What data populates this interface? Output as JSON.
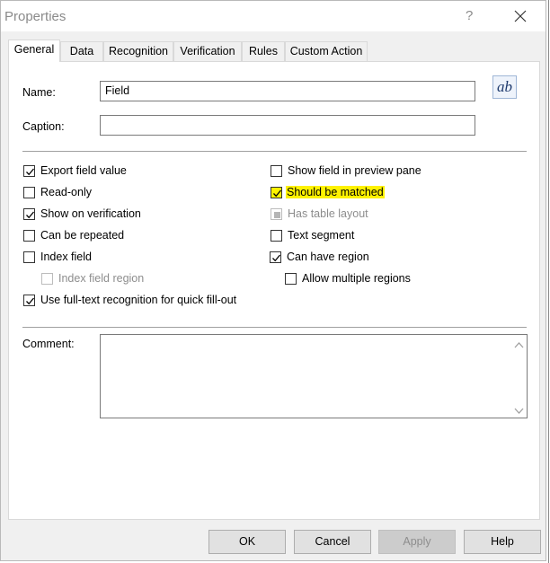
{
  "window": {
    "title": "Properties",
    "help_glyph": "?"
  },
  "tabs": [
    {
      "label": "General",
      "active": true
    },
    {
      "label": "Data"
    },
    {
      "label": "Recognition"
    },
    {
      "label": "Verification"
    },
    {
      "label": "Rules"
    },
    {
      "label": "Custom Action"
    }
  ],
  "general": {
    "name_label": "Name:",
    "name_value": "Field",
    "caption_label": "Caption:",
    "caption_value": "",
    "ab_button": "ab",
    "checkboxes_left": [
      {
        "label": "Export field value",
        "checked": true
      },
      {
        "label": "Read-only",
        "checked": false
      },
      {
        "label": "Show on verification",
        "checked": true
      },
      {
        "label": "Can be repeated",
        "checked": false
      },
      {
        "label": "Index field",
        "checked": false
      },
      {
        "label": "Index field region",
        "checked": false,
        "disabled": true
      },
      {
        "label": "Use full-text recognition for quick fill-out",
        "checked": true
      }
    ],
    "checkboxes_right": [
      {
        "label": "Show field in preview pane",
        "checked": false
      },
      {
        "label": "Should be matched",
        "checked": true,
        "highlight": "#fff200"
      },
      {
        "label": "Has table layout",
        "checked": false,
        "disabled": true,
        "indeterminate": true
      },
      {
        "label": "Text segment",
        "checked": false
      },
      {
        "label": "Can have region",
        "checked": true
      },
      {
        "label": "Allow multiple regions",
        "checked": false
      }
    ],
    "comment_label": "Comment:",
    "comment_value": ""
  },
  "buttons": {
    "ok": "OK",
    "cancel": "Cancel",
    "apply": "Apply",
    "help": "Help"
  }
}
